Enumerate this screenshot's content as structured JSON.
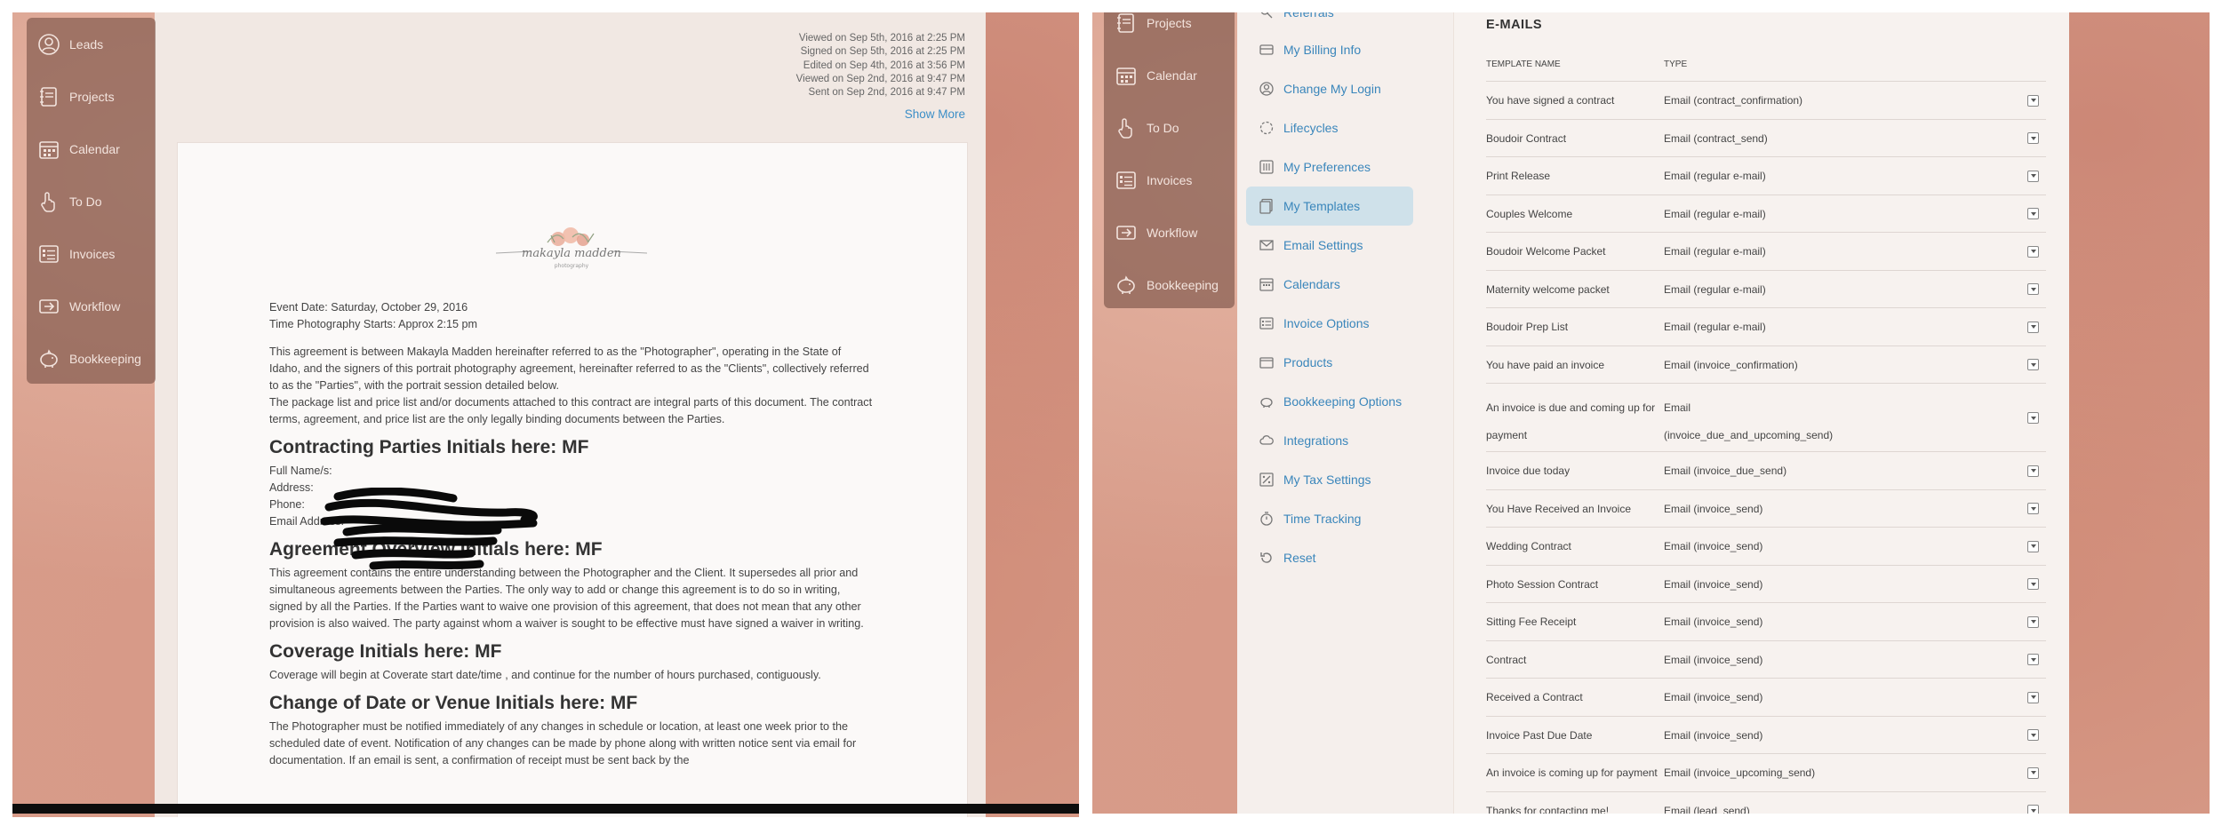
{
  "left": {
    "sidebar": [
      {
        "label": "Leads",
        "icon": "user-circle-icon"
      },
      {
        "label": "Projects",
        "icon": "notebook-icon"
      },
      {
        "label": "Calendar",
        "icon": "calendar-icon"
      },
      {
        "label": "To Do",
        "icon": "hand-pointer-icon"
      },
      {
        "label": "Invoices",
        "icon": "invoice-icon"
      },
      {
        "label": "Workflow",
        "icon": "workflow-icon"
      },
      {
        "label": "Bookkeeping",
        "icon": "piggy-bank-icon"
      }
    ],
    "activity": [
      "Viewed on Sep 5th, 2016 at 2:25 PM",
      "Signed on Sep 5th, 2016 at 2:25 PM",
      "Edited on Sep 4th, 2016 at 3:56 PM",
      "Viewed on Sep 2nd, 2016 at 9:47 PM",
      "Sent on Sep 2nd, 2016 at 9:47 PM"
    ],
    "show_more": "Show More",
    "doc": {
      "logo_text": "makayla madden",
      "logo_sub": "photography",
      "event_date": "Event Date: Saturday, October 29, 2016",
      "start_time": "Time Photography Starts: Approx  2:15 pm",
      "intro": "This agreement is between Makayla Madden hereinafter referred to as the \"Photographer\", operating in the State of Idaho, and the signers of this portrait photography agreement, hereinafter referred to as the \"Clients\", collectively referred to as the \"Parties\", with the portrait session detailed below.",
      "intro2": "The package list and price list and/or documents attached to this contract are integral parts of this document. The contract terms, agreement, and price list are the only legally binding documents between the Parties.",
      "h_parties": "Contracting Parties Initials here: MF",
      "full_name": "Full Name/s:",
      "address": "Address:",
      "phone": "Phone:",
      "email": "Email Address:",
      "h_overview": "Agreement Overview Initials here: MF",
      "overview": "This agreement contains the entire understanding between the Photographer and the Client. It supersedes all prior and simultaneous agreements between the Parties. The only way to add or change this agreement is to do so in writing, signed by all the Parties. If the Parties want to waive one provision of this agreement, that does not mean that any other provision is also waived. The party against whom a waiver is sought to be effective must have signed a waiver in writing.",
      "h_coverage": "Coverage Initials here: MF",
      "coverage": "Coverage will begin at Coverate start date/time , and continue for the number of hours purchased, contiguously.",
      "h_change": "Change of Date or Venue Initials here: MF",
      "change": "The Photographer must be notified immediately of any changes in schedule or location, at least one week prior to the scheduled date of event. Notification of any changes can be made by phone along with written notice sent via email for documentation. If an email is sent, a confirmation of receipt must be sent back by the"
    }
  },
  "right": {
    "sidebar": [
      {
        "label": "Projects",
        "icon": "notebook-icon"
      },
      {
        "label": "Calendar",
        "icon": "calendar-icon"
      },
      {
        "label": "To Do",
        "icon": "hand-pointer-icon"
      },
      {
        "label": "Invoices",
        "icon": "invoice-icon"
      },
      {
        "label": "Workflow",
        "icon": "workflow-icon"
      },
      {
        "label": "Bookkeeping",
        "icon": "piggy-bank-icon"
      }
    ],
    "menu": [
      {
        "label": "Referrals",
        "icon": "referrals-icon"
      },
      {
        "label": "My Billing Info",
        "icon": "billing-icon"
      },
      {
        "label": "Change My Login",
        "icon": "login-icon"
      },
      {
        "label": "Lifecycles",
        "icon": "lifecycle-icon"
      },
      {
        "label": "My Preferences",
        "icon": "preferences-icon"
      },
      {
        "label": "My Templates",
        "icon": "templates-icon",
        "active": true
      },
      {
        "label": "Email Settings",
        "icon": "envelope-icon"
      },
      {
        "label": "Calendars",
        "icon": "calendar-icon"
      },
      {
        "label": "Invoice Options",
        "icon": "invoice-options-icon"
      },
      {
        "label": "Products",
        "icon": "products-icon"
      },
      {
        "label": "Bookkeeping Options",
        "icon": "piggy-bank-icon"
      },
      {
        "label": "Integrations",
        "icon": "cloud-icon"
      },
      {
        "label": "My Tax Settings",
        "icon": "tax-icon"
      },
      {
        "label": "Time Tracking",
        "icon": "stopwatch-icon"
      },
      {
        "label": "Reset",
        "icon": "reset-icon"
      }
    ],
    "emails_title": "E-MAILS",
    "columns": {
      "name": "TEMPLATE NAME",
      "type": "TYPE"
    },
    "rows": [
      {
        "name": "You have signed a contract",
        "type": "Email (contract_confirmation)"
      },
      {
        "name": "Boudoir Contract",
        "type": "Email (contract_send)"
      },
      {
        "name": "Print Release",
        "type": "Email (regular e-mail)"
      },
      {
        "name": "Couples Welcome",
        "type": "Email (regular e-mail)"
      },
      {
        "name": "Boudoir Welcome Packet",
        "type": "Email (regular e-mail)"
      },
      {
        "name": "Maternity welcome packet",
        "type": "Email (regular e-mail)"
      },
      {
        "name": "Boudoir Prep List",
        "type": "Email (regular e-mail)"
      },
      {
        "name": "You have paid an invoice",
        "type": "Email (invoice_confirmation)"
      },
      {
        "name": "An invoice is due and coming up for",
        "name2": "payment",
        "type": "Email",
        "type2": "(invoice_due_and_upcoming_send)"
      },
      {
        "name": "Invoice due today",
        "type": "Email (invoice_due_send)"
      },
      {
        "name": "You Have Received an Invoice",
        "type": "Email (invoice_send)"
      },
      {
        "name": "Wedding Contract",
        "type": "Email (invoice_send)"
      },
      {
        "name": "Photo Session Contract",
        "type": "Email (invoice_send)"
      },
      {
        "name": "Sitting Fee Receipt",
        "type": "Email (invoice_send)"
      },
      {
        "name": "Contract",
        "type": "Email (invoice_send)"
      },
      {
        "name": "Received a Contract",
        "type": "Email (invoice_send)"
      },
      {
        "name": "Invoice Past Due Date",
        "type": "Email (invoice_send)"
      },
      {
        "name": "An invoice is coming up for payment",
        "type": "Email (invoice_upcoming_send)"
      },
      {
        "name": "Thanks for contacting me!",
        "type": "Email (lead_send)"
      }
    ]
  }
}
